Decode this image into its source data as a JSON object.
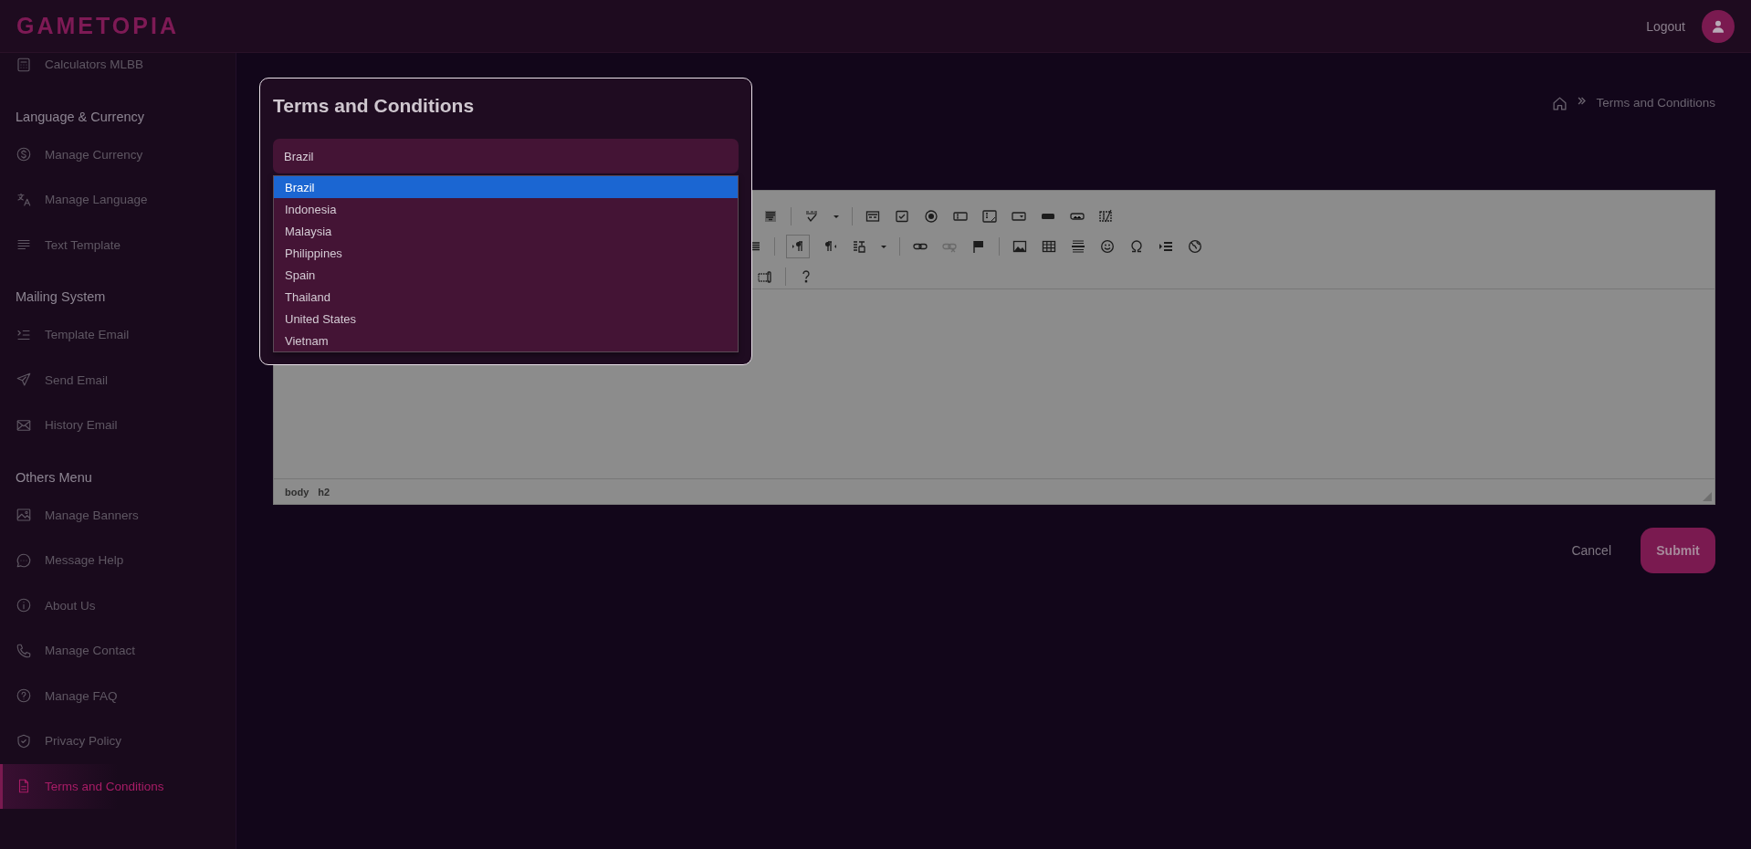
{
  "header": {
    "logo": "GAMETOPIA",
    "logout": "Logout"
  },
  "sidebar": {
    "items": [
      {
        "kind": "link",
        "label": "Calculators MLBB",
        "selected": false
      },
      {
        "kind": "heading",
        "label": "Language & Currency"
      },
      {
        "kind": "link",
        "label": "Manage Currency",
        "selected": false
      },
      {
        "kind": "link",
        "label": "Manage Language",
        "selected": false
      },
      {
        "kind": "link",
        "label": "Text Template",
        "selected": false
      },
      {
        "kind": "heading",
        "label": "Mailing System"
      },
      {
        "kind": "link",
        "label": "Template Email",
        "selected": false
      },
      {
        "kind": "link",
        "label": "Send Email",
        "selected": false
      },
      {
        "kind": "link",
        "label": "History Email",
        "selected": false
      },
      {
        "kind": "heading",
        "label": "Others Menu"
      },
      {
        "kind": "link",
        "label": "Manage Banners",
        "selected": false
      },
      {
        "kind": "link",
        "label": "Message Help",
        "selected": false
      },
      {
        "kind": "link",
        "label": "About Us",
        "selected": false
      },
      {
        "kind": "link",
        "label": "Manage Contact",
        "selected": false
      },
      {
        "kind": "link",
        "label": "Manage FAQ",
        "selected": false
      },
      {
        "kind": "link",
        "label": "Privacy Policy",
        "selected": false
      },
      {
        "kind": "link",
        "label": "Terms and Conditions",
        "selected": true
      }
    ]
  },
  "breadcrumb": {
    "current": "Terms and Conditions"
  },
  "editor": {
    "path": [
      "body",
      "h2"
    ]
  },
  "actions": {
    "cancel": "Cancel",
    "submit": "Submit"
  },
  "dialog": {
    "title": "Terms and Conditions",
    "select": {
      "value": "Brazil"
    },
    "options": [
      {
        "label": "Brazil",
        "selected": true
      },
      {
        "label": "Indonesia",
        "selected": false
      },
      {
        "label": "Malaysia",
        "selected": false
      },
      {
        "label": "Philippines",
        "selected": false
      },
      {
        "label": "Spain",
        "selected": false
      },
      {
        "label": "Thailand",
        "selected": false
      },
      {
        "label": "United States",
        "selected": false
      },
      {
        "label": "Vietnam",
        "selected": false
      }
    ]
  }
}
